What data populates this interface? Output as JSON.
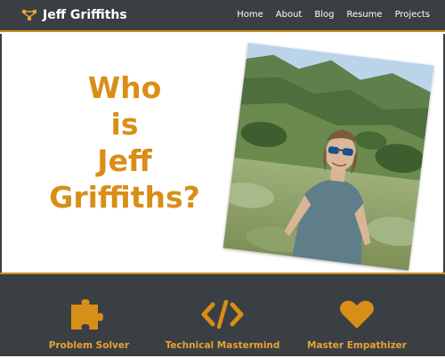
{
  "brand": {
    "name": "Jeff Griffiths",
    "logo_icon": "network-nodes-icon"
  },
  "nav": {
    "items": [
      {
        "label": "Home"
      },
      {
        "label": "About"
      },
      {
        "label": "Blog"
      },
      {
        "label": "Resume"
      },
      {
        "label": "Projects"
      }
    ]
  },
  "hero": {
    "title_lines": [
      "Who",
      "is",
      "Jeff",
      "Griffiths?"
    ],
    "photo_icon": "profile-photo"
  },
  "features": [
    {
      "icon": "puzzle-piece-icon",
      "label": "Problem Solver"
    },
    {
      "icon": "code-icon",
      "label": "Technical Mastermind"
    },
    {
      "icon": "heart-icon",
      "label": "Master Empathizer"
    }
  ],
  "colors": {
    "accent": "#d98e17",
    "nav_bg": "#3a3f44",
    "text_light": "#ffffff"
  }
}
